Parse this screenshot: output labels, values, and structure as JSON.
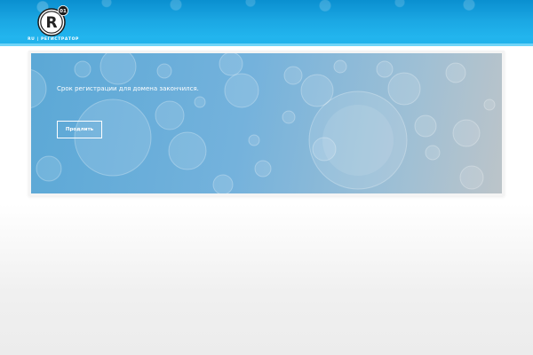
{
  "header": {
    "logo": {
      "mark": "R",
      "badge": "01",
      "tagline": "RU | РЕГИСТРАТОР",
      "colors": {
        "mark_fill": "#ffffff",
        "mark_letter": "#222222",
        "badge_fill": "#1b1b1b"
      }
    },
    "colors": {
      "top": "#0a8fd0",
      "bottom": "#22b5ee",
      "highlight": "#6fd4f7"
    }
  },
  "notice": {
    "message": "Срок регистрации для домена закончился.",
    "renew_button_label": "Продлить",
    "colors": {
      "panel_left": "#5ba8d6",
      "panel_right": "#bcc4c9",
      "text": "#ffffff"
    }
  }
}
